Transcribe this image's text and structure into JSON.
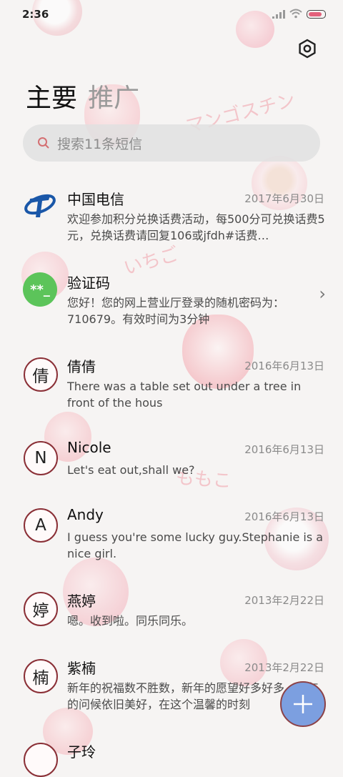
{
  "status_bar": {
    "time": "2:36",
    "battery_level": 0.85
  },
  "header": {
    "tabs": [
      "主要",
      "推广"
    ],
    "active_tab": "主要"
  },
  "search": {
    "placeholder": "搜索11条短信"
  },
  "watermarks": [
    "マンゴスチン",
    "いちご",
    "ももこ"
  ],
  "messages": [
    {
      "name": "中国电信",
      "date": "2017年6月30日",
      "preview": "欢迎参加积分兑换话费活动，每500分可兑换话费5元，兑换话费请回复106或jfdh#话费…",
      "avatar": {
        "type": "logo"
      }
    },
    {
      "name": "验证码",
      "date": "",
      "preview": "您好！您的网上营业厅登录的随机密码为：710679。有效时间为3分钟",
      "avatar": {
        "type": "code",
        "text": "**_"
      },
      "chevron": "›"
    },
    {
      "name": "倩倩",
      "date": "2016年6月13日",
      "preview": "There was a table set out under a tree in front of the hous",
      "avatar": {
        "type": "letter",
        "text": "倩"
      }
    },
    {
      "name": "Nicole",
      "date": "2016年6月13日",
      "preview": "Let's eat out,shall we?",
      "avatar": {
        "type": "letter",
        "text": "N"
      }
    },
    {
      "name": "Andy",
      "date": "2016年6月13日",
      "preview": "I guess you're some lucky guy.Stephanie is a nice girl.",
      "avatar": {
        "type": "letter",
        "text": "A"
      }
    },
    {
      "name": "燕婷",
      "date": "2013年2月22日",
      "preview": "嗯。收到啦。同乐同乐。",
      "avatar": {
        "type": "letter",
        "text": "婷"
      }
    },
    {
      "name": "紫楠",
      "date": "2013年2月22日",
      "preview": "新年的祝福数不胜数，新年的愿望好多好多，新年的问候依旧美好，在这个温馨的时刻",
      "avatar": {
        "type": "letter",
        "text": "楠"
      }
    },
    {
      "name": "子玲",
      "date": "",
      "preview": "",
      "avatar": {
        "type": "letter",
        "text": ""
      }
    }
  ],
  "colors": {
    "accent": "#7c9fe0",
    "avatar_ring": "#8a2f36",
    "code_avatar": "#5cc45a",
    "telecom_blue": "#1a57a8"
  }
}
